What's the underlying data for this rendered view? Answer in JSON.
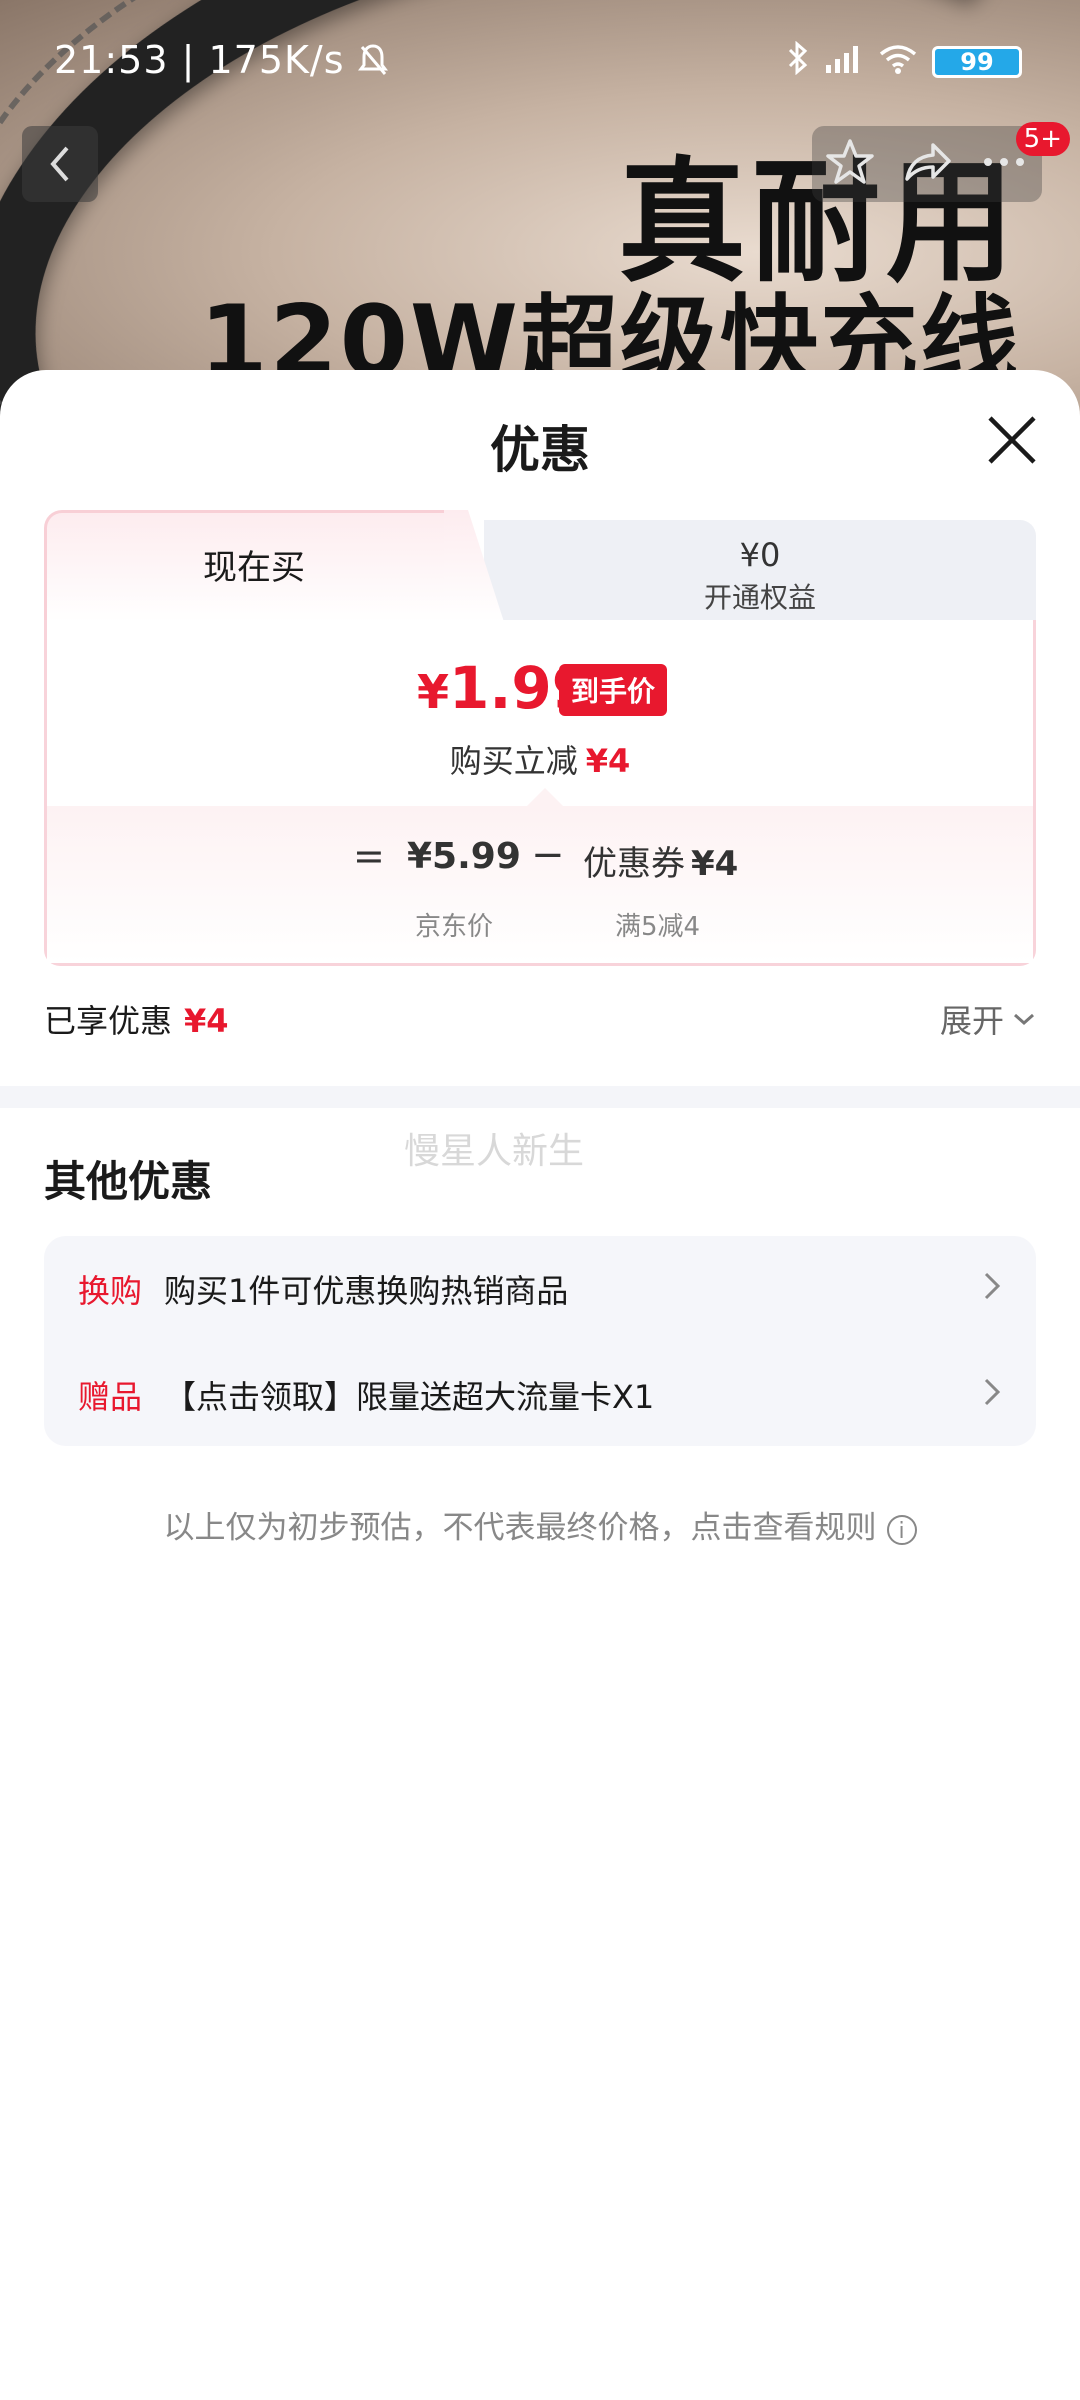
{
  "status_bar": {
    "time_speed": "21:53 | 175K/s",
    "battery": "99"
  },
  "banner": {
    "line1": "真耐用",
    "line2": "120W超级快充线"
  },
  "nav": {
    "badge": "5+"
  },
  "sheet": {
    "title": "优惠",
    "tabs": {
      "active_label": "现在买",
      "inactive_price": "¥0",
      "inactive_label": "开通权益"
    },
    "final_price": {
      "currency": "¥",
      "value": "1.99",
      "tag": "到手价"
    },
    "reduce": {
      "label": "购买立减",
      "amount": "¥4"
    },
    "calc": {
      "equals": "=",
      "jd_price": "¥5.99",
      "minus": "−",
      "coupon_label": "优惠券",
      "coupon_amount": "¥4",
      "jd_price_label": "京东价",
      "coupon_rule": "满5减4"
    },
    "enjoyed": {
      "label": "已享优惠",
      "amount": "¥4"
    },
    "expand_label": "展开",
    "watermark": "慢星人新生",
    "other": {
      "title": "其他优惠",
      "items": [
        {
          "tag": "换购",
          "text": "购买1件可优惠换购热销商品"
        },
        {
          "tag": "赠品",
          "text": "【点击领取】限量送超大流量卡X1"
        }
      ]
    },
    "disclaimer": "以上仅为初步预估，不代表最终价格，点击查看规则",
    "icons": {
      "close": "close-icon",
      "back": "chevron-left-icon",
      "star": "star-icon",
      "share": "share-icon",
      "more": "more-icon",
      "chevron": "chevron-right-icon",
      "expand": "chevron-down-icon",
      "info": "info-icon"
    }
  },
  "colors": {
    "accent_red": "#e8182e",
    "pink_border": "#f8cfd6",
    "panel_gray": "#f5f6fa"
  }
}
